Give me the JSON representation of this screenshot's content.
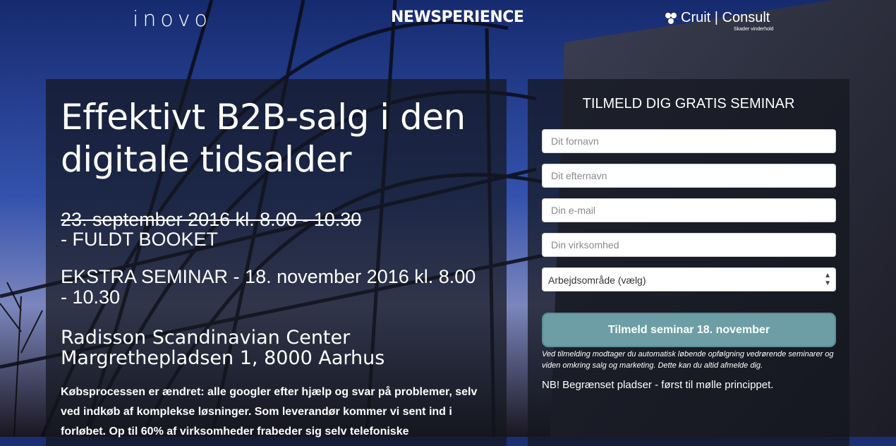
{
  "header": {
    "logo_inovo": "inovo",
    "logo_newsperience": "NEWSPERIENCE",
    "logo_cruit": "Cruit | Consult",
    "logo_cruit_sub": "Skader vinderhold"
  },
  "hero": {
    "headline": "Effektivt B2B-salg i den digitale tidsalder",
    "date_old": "23. september 2016 kl. 8.00 - 10.30",
    "date_status": "- FULDT BOOKET",
    "extra_seminar": "EKSTRA SEMINAR - 18. november 2016 kl. 8.00 - 10.30",
    "venue_name": "Radisson Scandinavian Center",
    "venue_address": "Margrethepladsen 1, 8000 Aarhus",
    "body": "Købsprocessen er ændret: alle googler efter hjælp og svar på problemer, selv ved indkøb af komplekse løsninger. Som leverandør kommer vi sent ind i forløbet. Op til 60% af virksomheder frabeder sig selv telefoniske"
  },
  "form": {
    "title": "TILMELD DIG GRATIS SEMINAR",
    "first_name_placeholder": "Dit fornavn",
    "last_name_placeholder": "Dit efternavn",
    "email_placeholder": "Din e-mail",
    "company_placeholder": "Din virksomhed",
    "work_area_selected": "Arbejdsområde (vælg)",
    "submit_label": "Tilmeld seminar 18. november",
    "disclaimer": "Ved tilmelding modtager du automatisk løbende opfølgning vedrørende seminarer og viden omkring salg og marketing. Dette kan du altid afmelde dig.",
    "note": "NB! Begrænset pladser - først til mølle princippet."
  },
  "colors": {
    "submit_bg": "#6d9ea5",
    "panel_overlay": "rgba(20,22,30,0.72)"
  }
}
